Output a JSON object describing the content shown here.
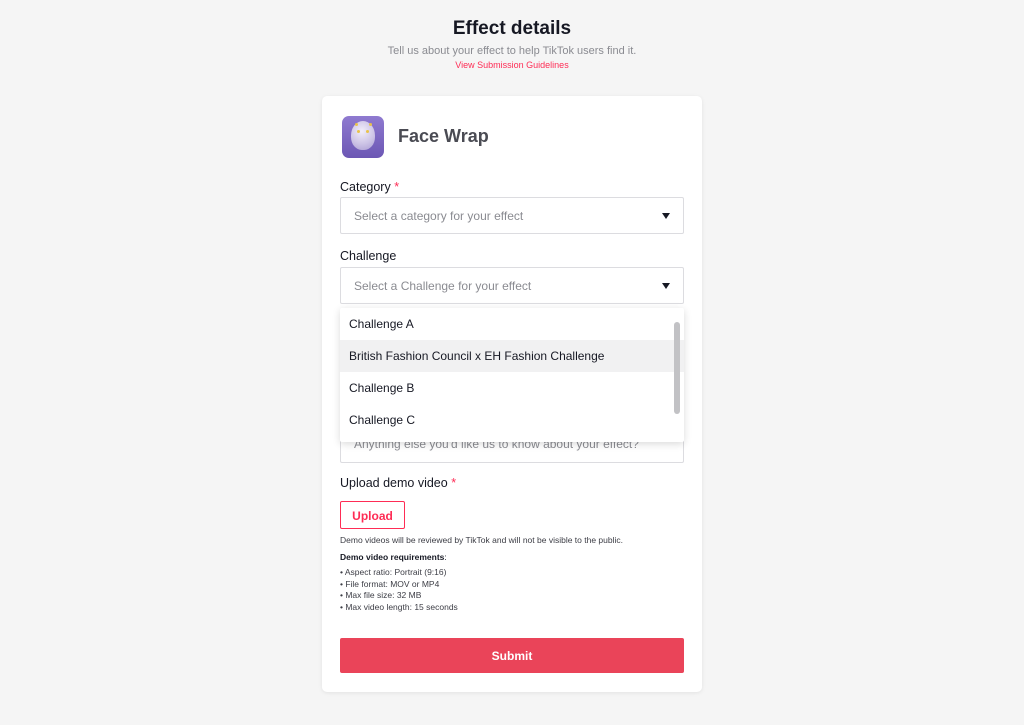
{
  "header": {
    "title": "Effect details",
    "subtitle": "Tell us about your effect to help TikTok users find it.",
    "guidelines_link": "View Submission Guidelines"
  },
  "effect": {
    "name": "Face Wrap",
    "icon": "face-wrap-effect-icon"
  },
  "form": {
    "category": {
      "label": "Category",
      "required_mark": "*",
      "placeholder": "Select a category for your effect"
    },
    "challenge": {
      "label": "Challenge",
      "placeholder": "Select a Challenge for your effect",
      "options": [
        "Challenge A",
        "British Fashion Council x EH Fashion Challenge",
        "Challenge B",
        "Challenge C"
      ],
      "highlighted_option": "British Fashion Council x EH Fashion Challenge"
    },
    "notes": {
      "placeholder": "Anything else you'd like us to know about your effect?"
    },
    "upload": {
      "label": "Upload demo video",
      "required_mark": "*",
      "button": "Upload",
      "note": "Demo videos will be reviewed by TikTok and will not be visible to the public.",
      "requirements_title": "Demo video requirements",
      "requirements_suffix": ":",
      "requirements": [
        "• Aspect ratio: Portrait (9:16)",
        "• File format: MOV or MP4",
        "• Max file size: 32 MB",
        "• Max video length: 15 seconds"
      ]
    },
    "submit": "Submit"
  },
  "colors": {
    "accent": "#fe2c55",
    "submit_bg": "#ea4459",
    "page_bg": "#f5f5f5"
  }
}
